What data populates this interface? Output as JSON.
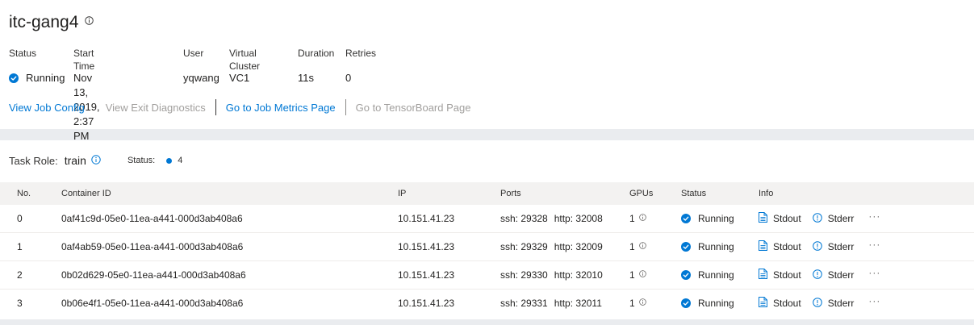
{
  "job": {
    "title": "itc-gang4",
    "meta": {
      "status_label": "Status",
      "start_label": "Start Time",
      "user_label": "User",
      "vc_label": "Virtual Cluster",
      "duration_label": "Duration",
      "retries_label": "Retries",
      "status_value": "Running",
      "start_value": "Nov 13, 2019, 2:37 PM",
      "user_value": "yqwang",
      "vc_value": "VC1",
      "duration_value": "11s",
      "retries_value": "0"
    },
    "links": {
      "view_config": "View Job Config",
      "view_exit": "View Exit Diagnostics",
      "metrics": "Go to Job Metrics Page",
      "tensorboard": "Go to TensorBoard Page"
    }
  },
  "task": {
    "role_label": "Task Role:",
    "role_value": "train",
    "status_label": "Status:",
    "status_count": "4",
    "columns": {
      "no": "No.",
      "container_id": "Container ID",
      "ip": "IP",
      "ports": "Ports",
      "gpus": "GPUs",
      "status": "Status",
      "info": "Info"
    },
    "rows": [
      {
        "no": "0",
        "container_id": "0af41c9d-05e0-11ea-a441-000d3ab408a6",
        "ip": "10.151.41.23",
        "ssh": "ssh: 29328",
        "http": "http: 32008",
        "gpus": "1",
        "status": "Running",
        "stdout": "Stdout",
        "stderr": "Stderr",
        "more": "···"
      },
      {
        "no": "1",
        "container_id": "0af4ab59-05e0-11ea-a441-000d3ab408a6",
        "ip": "10.151.41.23",
        "ssh": "ssh: 29329",
        "http": "http: 32009",
        "gpus": "1",
        "status": "Running",
        "stdout": "Stdout",
        "stderr": "Stderr",
        "more": "···"
      },
      {
        "no": "2",
        "container_id": "0b02d629-05e0-11ea-a441-000d3ab408a6",
        "ip": "10.151.41.23",
        "ssh": "ssh: 29330",
        "http": "http: 32010",
        "gpus": "1",
        "status": "Running",
        "stdout": "Stdout",
        "stderr": "Stderr",
        "more": "···"
      },
      {
        "no": "3",
        "container_id": "0b06e4f1-05e0-11ea-a441-000d3ab408a6",
        "ip": "10.151.41.23",
        "ssh": "ssh: 29331",
        "http": "http: 32011",
        "gpus": "1",
        "status": "Running",
        "stdout": "Stdout",
        "stderr": "Stderr",
        "more": "···"
      }
    ]
  },
  "icons": {
    "job_info": "info-icon",
    "status_running": "check-circle-icon",
    "stdout": "document-icon",
    "stderr": "alert-circle-icon",
    "more": "more-horizontal-icon"
  },
  "colors": {
    "accent": "#0078d4",
    "disabled_link": "#a19f9d",
    "background": "#eaecef",
    "header_row": "#f3f2f1"
  }
}
